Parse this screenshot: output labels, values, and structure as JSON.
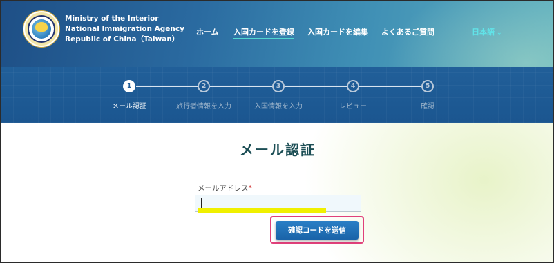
{
  "header": {
    "org_lines": [
      "Ministry of the Interior",
      "National Immigration Agency",
      "Republic of China（Taiwan）"
    ],
    "nav": [
      {
        "label": "ホーム"
      },
      {
        "label": "入国カードを登録",
        "active": true
      },
      {
        "label": "入国カードを編集"
      },
      {
        "label": "よくあるご質問"
      }
    ],
    "language": "日本語",
    "language_icon": "chevron-down-icon"
  },
  "steps": [
    {
      "number": "1",
      "label": "メール認証",
      "active": true
    },
    {
      "number": "2",
      "label": "旅行者情報を入力",
      "active": false
    },
    {
      "number": "3",
      "label": "入国情報を入力",
      "active": false
    },
    {
      "number": "4",
      "label": "レビュー",
      "active": false
    },
    {
      "number": "5",
      "label": "確認",
      "active": false
    }
  ],
  "main": {
    "title": "メール認証",
    "email_label": "メールアドレス",
    "required_mark": "*",
    "email_value": "",
    "send_button": "確認コードを送信"
  },
  "colors": {
    "header_start": "#1e4f86",
    "header_end": "#5fb0bf",
    "steps_band": "#1e5b96",
    "accent_teal": "#52d6d0",
    "button": "#1a63a8",
    "highlight_border": "#e0407a",
    "marker": "#f0f000"
  }
}
